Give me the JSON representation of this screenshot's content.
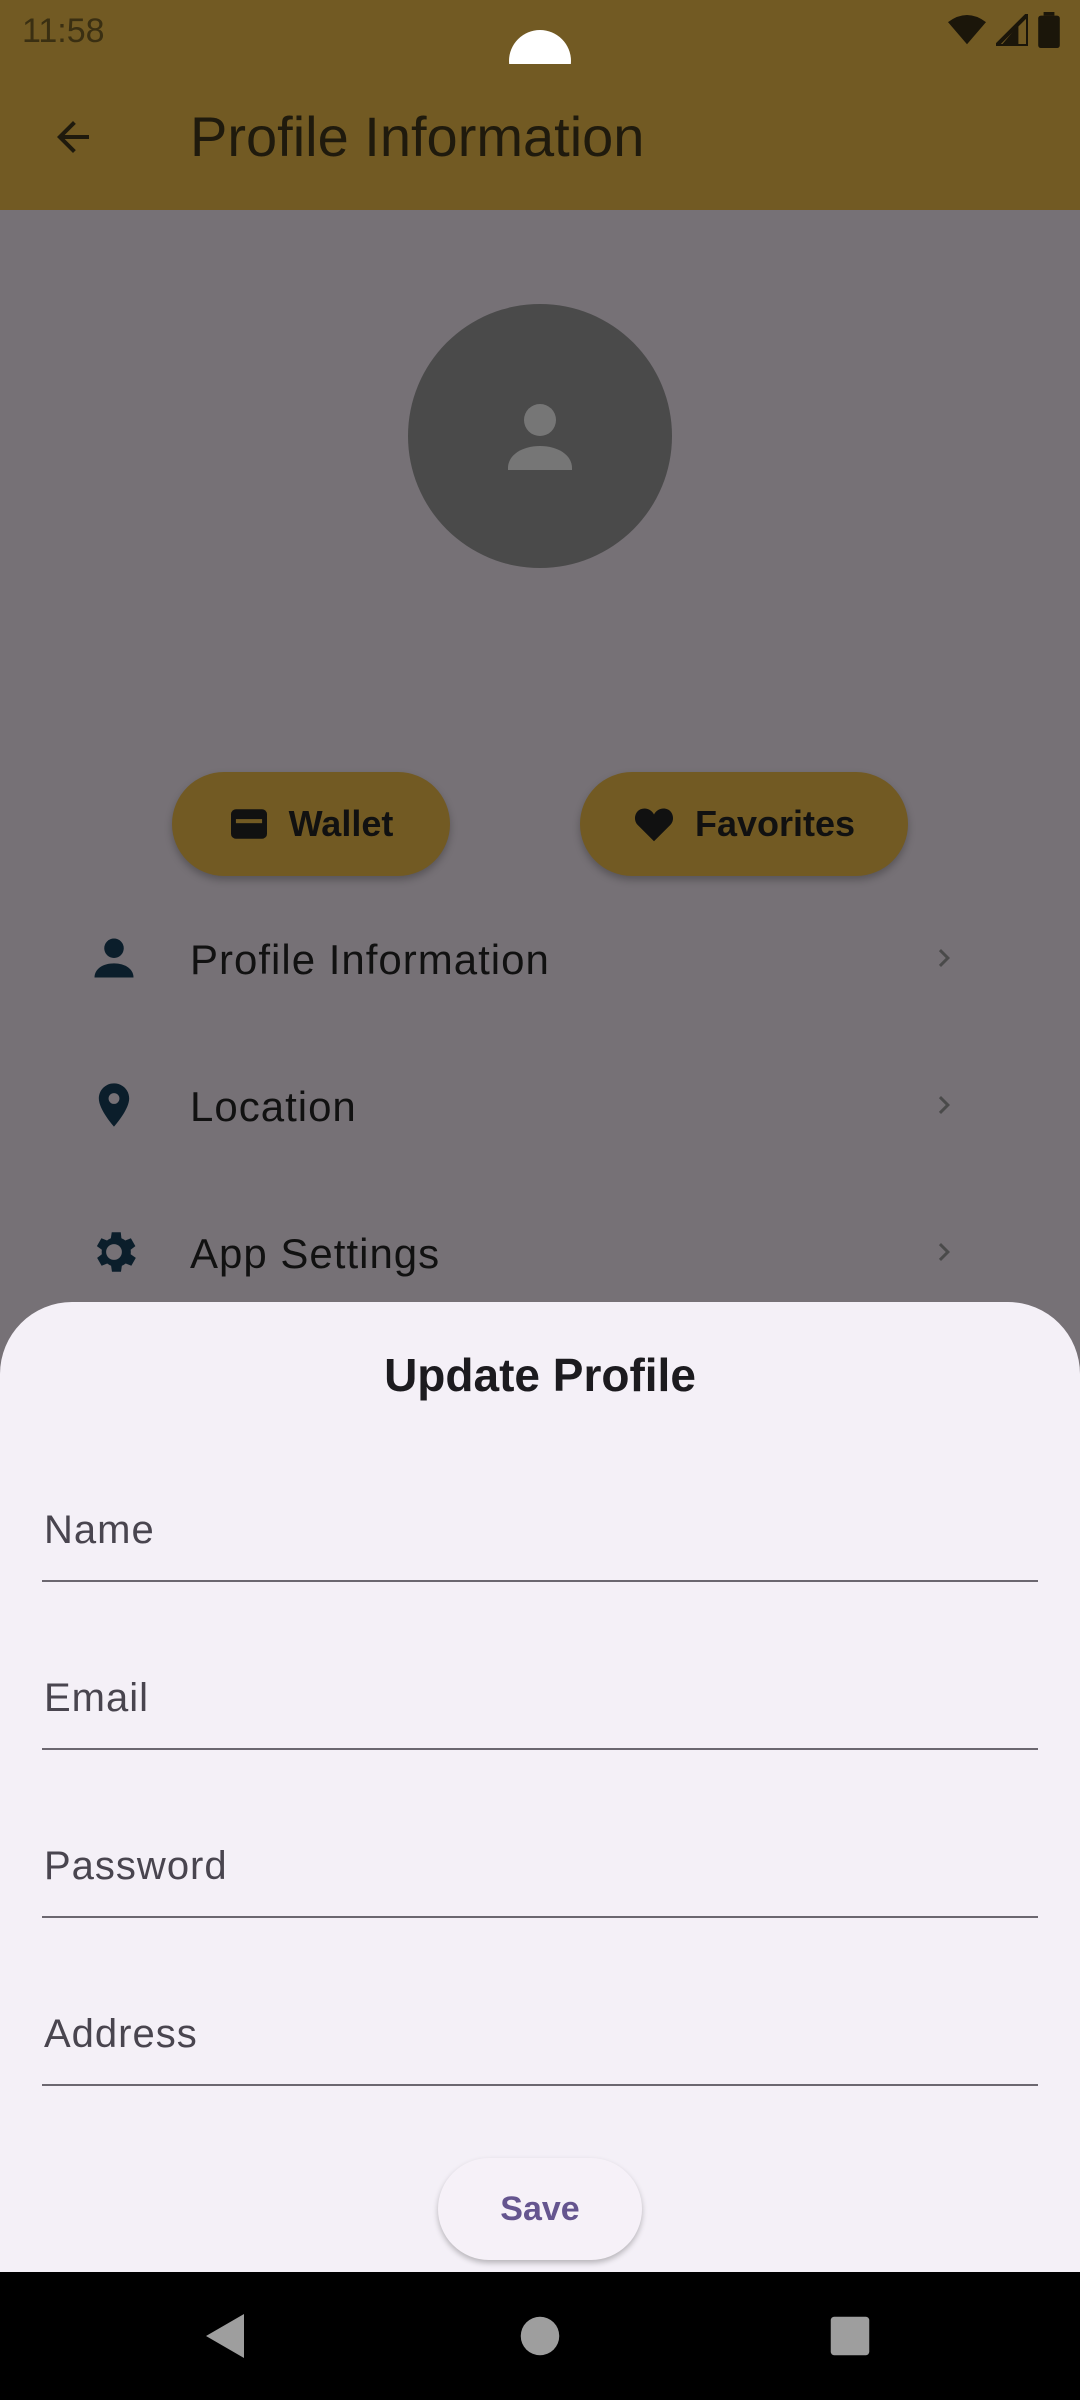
{
  "status_bar": {
    "time": "11:58"
  },
  "app_bar": {
    "title": "Profile Information"
  },
  "quick_actions": {
    "wallet": "Wallet",
    "favorites": "Favorites"
  },
  "menu": {
    "items": [
      {
        "label": "Profile Information",
        "icon": "person-icon"
      },
      {
        "label": "Location",
        "icon": "location-pin-icon"
      },
      {
        "label": "App Settings",
        "icon": "gear-icon"
      }
    ]
  },
  "sheet": {
    "title": "Update Profile",
    "fields": {
      "name": {
        "placeholder": "Name",
        "value": ""
      },
      "email": {
        "placeholder": "Email",
        "value": ""
      },
      "password": {
        "placeholder": "Password",
        "value": ""
      },
      "address": {
        "placeholder": "Address",
        "value": ""
      }
    },
    "save_label": "Save"
  },
  "colors": {
    "brand": "#725a23",
    "scrim_background": "#767176",
    "sheet_background": "#f4f0f7",
    "accent_text": "#65558f"
  }
}
